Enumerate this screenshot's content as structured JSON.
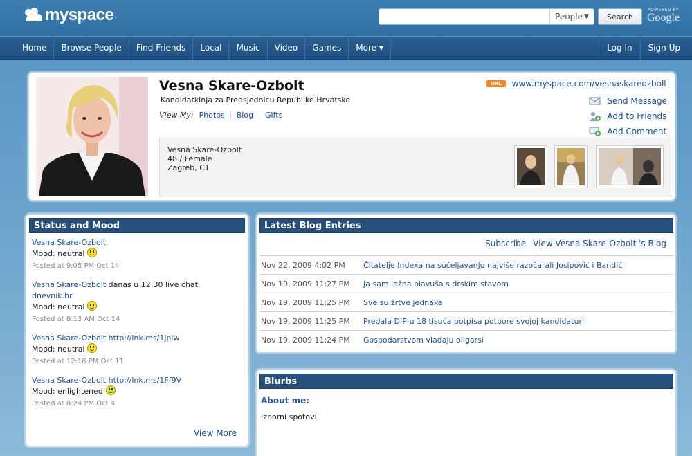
{
  "header": {
    "logo_text": "myspace",
    "logo_dot": ".",
    "search_placeholder": "",
    "search_type": "People",
    "search_button": "Search",
    "powered_line": "POWERED BY",
    "powered_brand": "Google"
  },
  "nav": {
    "items": [
      "Home",
      "Browse People",
      "Find Friends",
      "Local",
      "Music",
      "Video",
      "Games",
      "More ▾"
    ],
    "right": [
      "Log In",
      "Sign Up"
    ]
  },
  "profile": {
    "name": "Vesna Skare-Ozbolt",
    "subtitle": "Kandidatkinja za Predsjednicu Republike Hrvatske",
    "view_my_label": "View My:",
    "view_links": [
      "Photos",
      "Blog",
      "Gifts"
    ],
    "url_badge": "URL",
    "url": "www.myspace.com/vesnaskareozbolt",
    "actions": [
      "Send Message",
      "Add to Friends",
      "Add Comment"
    ],
    "info": [
      "Vesna Skare-Ozbolt",
      "48 / Female",
      "Zagreb, CT"
    ]
  },
  "status": {
    "title": "Status and Mood",
    "items": [
      {
        "name": "Vesna Skare-Ozbolt",
        "text": "",
        "text2": "",
        "mood": "Mood: neutral",
        "posted": "Posted at 9:05 PM Oct 14"
      },
      {
        "name": "Vesna Skare-Ozbolt",
        "text": " danas u 12:30 live chat,",
        "text2": "dnevnik.hr",
        "mood": "Mood: neutral",
        "posted": "Posted at 8:13 AM Oct 14"
      },
      {
        "name": "Vesna Skare-Ozbolt",
        "text": " http://lnk.ms/1jplw",
        "text2": "",
        "mood": "Mood: neutral",
        "posted": "Posted at 12:18 PM Oct 11"
      },
      {
        "name": "Vesna Skare-Ozbolt",
        "text": " http://lnk.ms/1Ff9V",
        "text2": "",
        "mood": "Mood: enlightened",
        "posted": "Posted at 8:24 PM Oct 4"
      }
    ],
    "view_more": "View More"
  },
  "blog": {
    "title": "Latest Blog Entries",
    "subscribe": "Subscribe",
    "view_blog": "View Vesna Skare-Ozbolt 's Blog",
    "entries": [
      {
        "date": "Nov 22, 2009 4:02 PM",
        "title": "Čitatelje Indexa na sučeljavanju najviše razočarali Josipović i Bandić"
      },
      {
        "date": "Nov 19, 2009 11:27 PM",
        "title": "Ja sam lažna plavuša s drskim stavom"
      },
      {
        "date": "Nov 19, 2009 11:25 PM",
        "title": "Sve su žrtve jednake"
      },
      {
        "date": "Nov 19, 2009 11:25 PM",
        "title": "Predala DIP-u 18 tisuća potpisa potpore svojoj kandidaturi"
      },
      {
        "date": "Nov 19, 2009 11:24 PM",
        "title": "Gospodarstvom vladaju oligarsi"
      }
    ]
  },
  "blurbs": {
    "title": "Blurbs",
    "about_label": "About me:",
    "about_text": "Izborni spotovi"
  },
  "colors": {
    "link": "#1d4fa0",
    "section_header": "#274f7c",
    "url_badge": "#f08a1c"
  }
}
